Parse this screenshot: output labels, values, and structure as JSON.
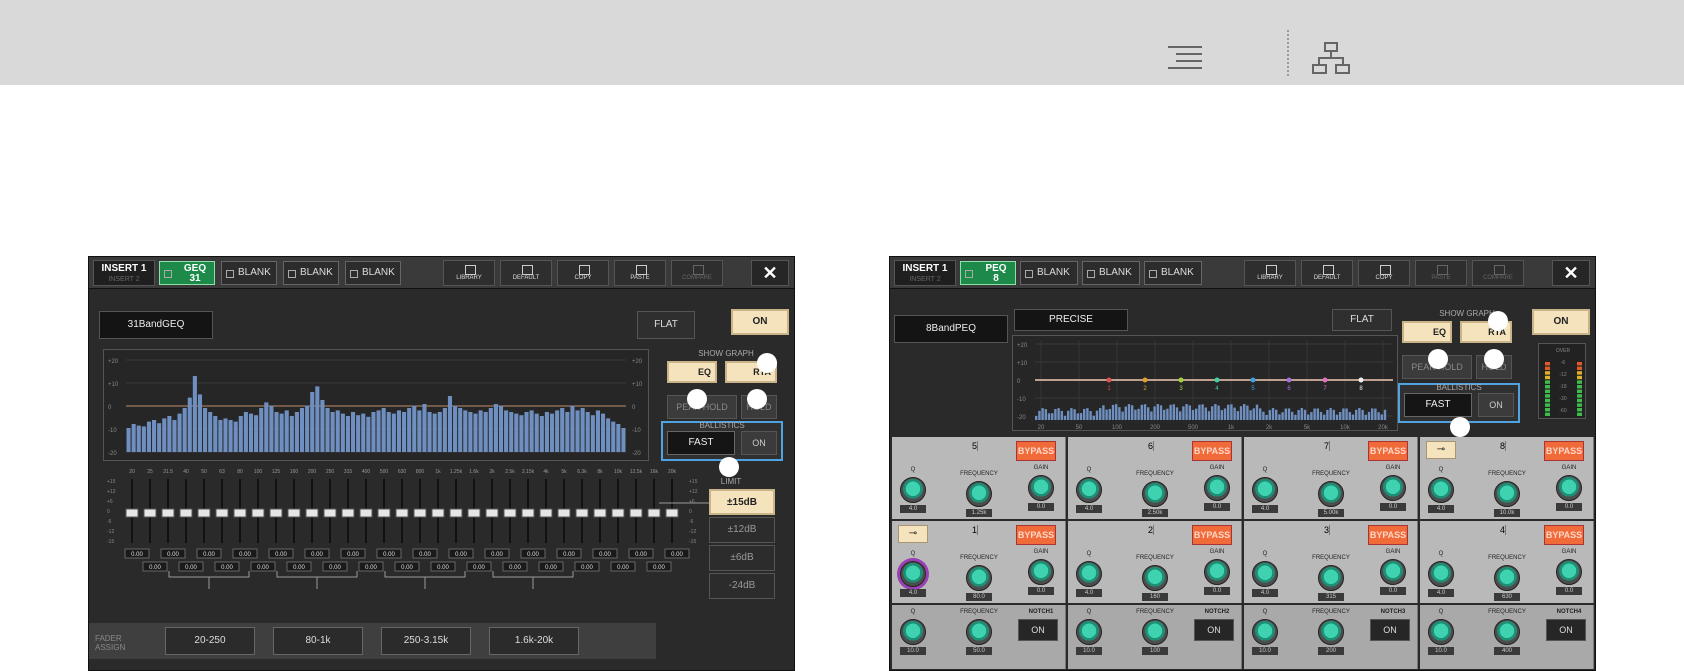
{
  "colors": {
    "accent_on": "#f4e3bc",
    "bypass": "#f06a3a",
    "highlight": "#4fa3e0",
    "knob": "#3fd2b0",
    "bars": "#6e8fbf"
  },
  "topbar": {
    "menu_icon": "menu-lines-icon",
    "tree_icon": "hierarchy-icon"
  },
  "geq": {
    "insert": {
      "label": "INSERT 1",
      "sub": "INSERT 2"
    },
    "slots": [
      "GEQ\n31",
      "BLANK",
      "BLANK",
      "BLANK"
    ],
    "toolbar": [
      "LIBRARY",
      "DEFAULT",
      "COPY",
      "PASTE",
      "COMPARE"
    ],
    "close": "✕",
    "name": "31BandGEQ",
    "flat": "FLAT",
    "on": "ON",
    "show_graph": "SHOW GRAPH",
    "eq": "EQ",
    "rta": "RTA",
    "peak_hold": "PEAK HOLD",
    "hold": "HOLD",
    "ballistics": "BALLISTICS",
    "fast": "FAST",
    "ballistics_on": "ON",
    "limit": "LIMIT",
    "limits": [
      "±15dB",
      "±12dB",
      "±6dB",
      "-24dB"
    ],
    "graph_left": [
      "+20",
      "+10",
      "0",
      "-10",
      "-20"
    ],
    "graph_right": [
      "+20",
      "+10",
      "0",
      "-10",
      "-20"
    ],
    "freqs": [
      "20",
      "25",
      "31.5",
      "40",
      "50",
      "63",
      "80",
      "100",
      "125",
      "160",
      "200",
      "250",
      "315",
      "400",
      "500",
      "630",
      "800",
      "1k",
      "1.25k",
      "1.6k",
      "2k",
      "2.5k",
      "3.15k",
      "4k",
      "5k",
      "6.3k",
      "8k",
      "10k",
      "12.5k",
      "16k",
      "20k"
    ],
    "fader_scale": [
      "+15",
      "+12",
      "+6",
      "0",
      "-6",
      "-12",
      "-15"
    ],
    "gain_value": "0.00",
    "fader_assign": "FADER\nASSIGN",
    "assign_ranges": [
      "20-250",
      "80-1k",
      "250-3.15k",
      "1.6k-20k"
    ],
    "rta_levels": [
      0.3,
      0.35,
      0.33,
      0.32,
      0.38,
      0.4,
      0.36,
      0.42,
      0.45,
      0.4,
      0.48,
      0.55,
      0.68,
      0.95,
      0.72,
      0.55,
      0.5,
      0.45,
      0.4,
      0.42,
      0.4,
      0.38,
      0.45,
      0.5,
      0.48,
      0.46,
      0.55,
      0.62,
      0.58,
      0.5,
      0.48,
      0.52,
      0.45,
      0.5,
      0.55,
      0.58,
      0.75,
      0.82,
      0.65,
      0.55,
      0.5,
      0.52,
      0.48,
      0.45,
      0.5,
      0.46,
      0.48,
      0.44,
      0.5,
      0.52,
      0.55,
      0.5,
      0.48,
      0.52,
      0.5,
      0.55,
      0.58,
      0.52,
      0.6,
      0.5,
      0.48,
      0.5,
      0.55,
      0.7,
      0.58,
      0.55,
      0.52,
      0.5,
      0.48,
      0.52,
      0.5,
      0.55,
      0.6,
      0.58,
      0.52,
      0.5,
      0.48,
      0.46,
      0.5,
      0.52,
      0.48,
      0.45,
      0.5,
      0.48,
      0.52,
      0.55,
      0.5,
      0.58,
      0.52,
      0.55,
      0.5,
      0.46,
      0.52,
      0.48,
      0.42,
      0.38,
      0.35,
      0.3
    ]
  },
  "peq": {
    "insert": {
      "label": "INSERT 1",
      "sub": "INSERT 2"
    },
    "slots": [
      "PEQ\n8",
      "BLANK",
      "BLANK",
      "BLANK"
    ],
    "toolbar": [
      "LIBRARY",
      "DEFAULT",
      "COPY",
      "PASTE",
      "COMPARE"
    ],
    "close": "✕",
    "name": "8BandPEQ",
    "mode": "PRECISE",
    "flat": "FLAT",
    "on": "ON",
    "show_graph": "SHOW GRAPH",
    "eq": "EQ",
    "rta": "RTA",
    "peak_hold": "PEAK HOLD",
    "hold": "HOLD",
    "ballistics": "BALLISTICS",
    "fast": "FAST",
    "ballistics_on": "ON",
    "graph_left": [
      "+20",
      "+10",
      "0",
      "-10",
      "-20"
    ],
    "graph_x": [
      "20",
      "50",
      "100",
      "200",
      "500",
      "1k",
      "2k",
      "5k",
      "10k",
      "20k"
    ],
    "band_markers": [
      "1",
      "2",
      "3",
      "4",
      "5",
      "6",
      "7",
      "8"
    ],
    "meter_scale": [
      "OVER",
      "-6",
      "-12",
      "-18",
      "-30",
      "-60"
    ],
    "bypass": "BYPASS",
    "q": "Q",
    "frequency": "FREQUENCY",
    "gain": "GAIN",
    "upper_bands": [
      {
        "num": "5",
        "q": "4.0",
        "freq": "1.25k",
        "gain": "0.0"
      },
      {
        "num": "6",
        "q": "4.0",
        "freq": "2.50k",
        "gain": "0.0"
      },
      {
        "num": "7",
        "q": "4.0",
        "freq": "5.00k",
        "gain": "0.0"
      },
      {
        "num": "8",
        "q": "4.0",
        "freq": "10.0k",
        "gain": "0.0"
      }
    ],
    "lower_bands": [
      {
        "num": "1",
        "q": "4.0",
        "freq": "80.0",
        "gain": "0.0"
      },
      {
        "num": "2",
        "q": "4.0",
        "freq": "160",
        "gain": "0.0"
      },
      {
        "num": "3",
        "q": "4.0",
        "freq": "315",
        "gain": "0.0"
      },
      {
        "num": "4",
        "q": "4.0",
        "freq": "630",
        "gain": "0.0"
      }
    ],
    "notches": [
      {
        "label": "NOTCH1",
        "q": "10.0",
        "freq": "50.0",
        "on": "ON"
      },
      {
        "label": "NOTCH2",
        "q": "10.0",
        "freq": "100",
        "on": "ON"
      },
      {
        "label": "NOTCH3",
        "q": "10.0",
        "freq": "200",
        "on": "ON"
      },
      {
        "label": "NOTCH4",
        "q": "10.0",
        "freq": "400",
        "on": "ON"
      }
    ]
  }
}
